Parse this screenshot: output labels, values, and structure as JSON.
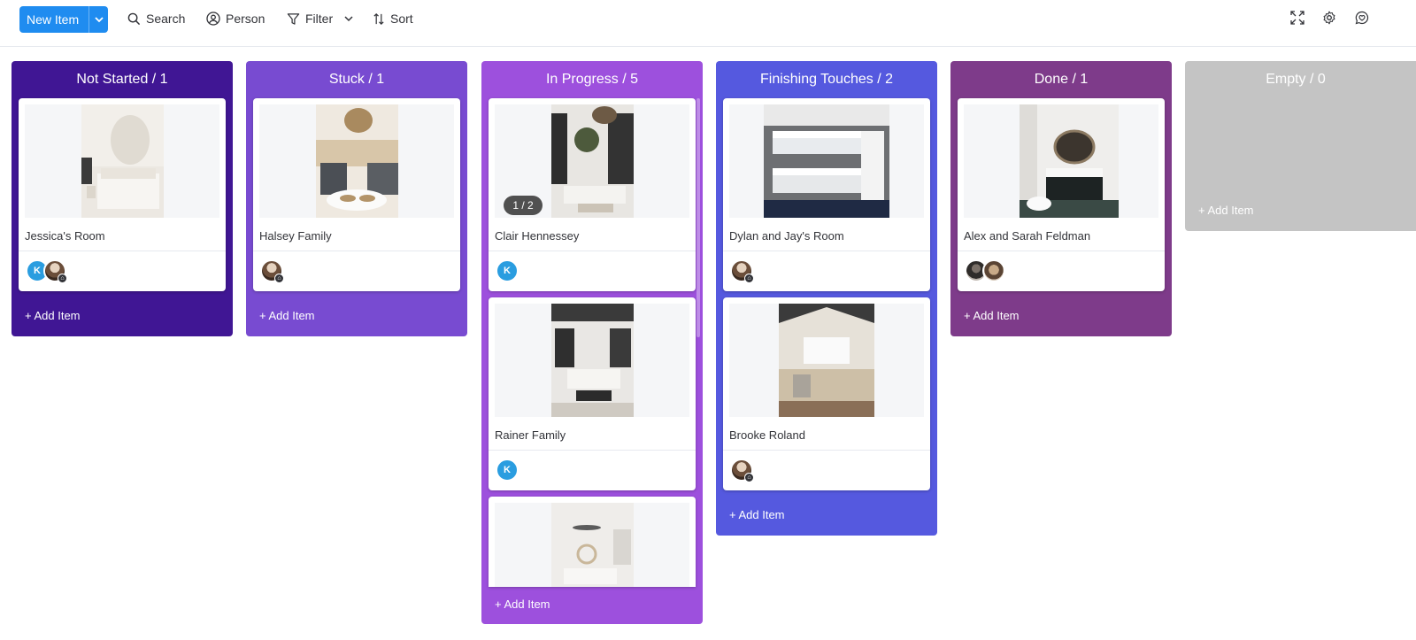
{
  "toolbar": {
    "new_item_label": "New Item",
    "search_label": "Search",
    "person_label": "Person",
    "filter_label": "Filter",
    "sort_label": "Sort"
  },
  "colors": {
    "primary": "#1f8cf0",
    "not_started": "#401694",
    "stuck": "#784bd1",
    "in_progress": "#9d50dd",
    "finishing_touches": "#5559df",
    "done": "#7e3b8a",
    "empty": "#c4c4c4"
  },
  "columns": [
    {
      "title": "Not Started / 1",
      "add_label": "+ Add Item",
      "cards": [
        {
          "title": "Jessica's Room",
          "people": [
            "K",
            "photo"
          ]
        }
      ]
    },
    {
      "title": "Stuck / 1",
      "add_label": "+ Add Item",
      "cards": [
        {
          "title": "Halsey Family",
          "people": [
            "photo"
          ]
        }
      ]
    },
    {
      "title": "In Progress / 5",
      "add_label": "+ Add Item",
      "cards": [
        {
          "title": "Clair Hennessey",
          "image_counter": "1 / 2",
          "people": [
            "K"
          ]
        },
        {
          "title": "Rainer Family",
          "people": [
            "K"
          ]
        },
        {
          "title": "",
          "people": []
        }
      ]
    },
    {
      "title": "Finishing Touches / 2",
      "add_label": "+ Add Item",
      "cards": [
        {
          "title": "Dylan and Jay's Room",
          "people": [
            "photo"
          ]
        },
        {
          "title": "Brooke Roland",
          "people": [
            "photo"
          ]
        }
      ]
    },
    {
      "title": "Done / 1",
      "add_label": "+ Add Item",
      "cards": [
        {
          "title": "Alex and Sarah Feldman",
          "people": [
            "photo",
            "photo"
          ]
        }
      ]
    },
    {
      "title": "Empty / 0",
      "add_label": "+ Add Item",
      "cards": []
    }
  ]
}
